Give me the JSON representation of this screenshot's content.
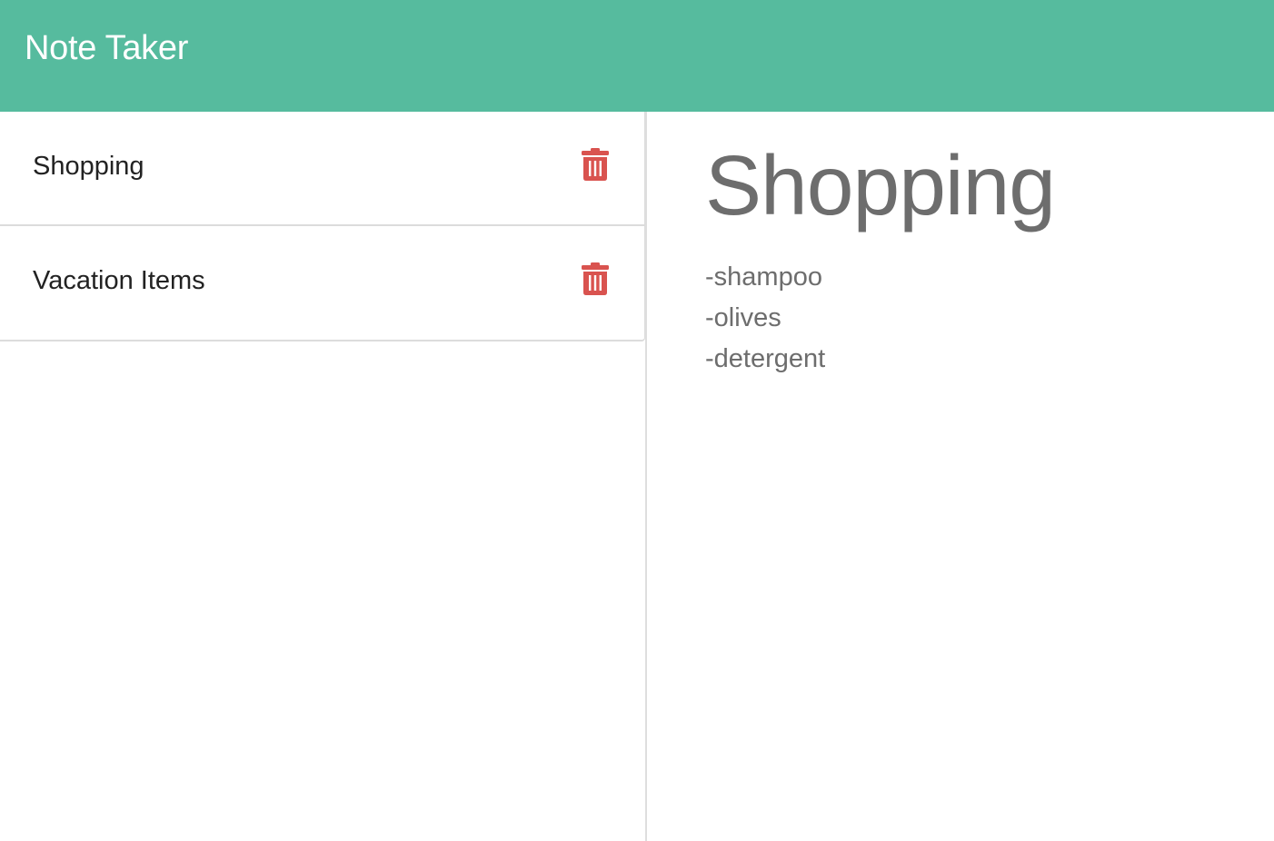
{
  "app": {
    "title": "Note Taker"
  },
  "notes": [
    {
      "title": "Shopping",
      "delete_icon": "trash-icon"
    },
    {
      "title": "Vacation Items",
      "delete_icon": "trash-icon"
    }
  ],
  "active_note": {
    "title": "Shopping",
    "lines": [
      "-shampoo",
      "-olives",
      "-detergent"
    ]
  },
  "colors": {
    "navbar": "#56bb9e",
    "delete": "#d9534f",
    "note_text": "#6d6d6d"
  }
}
